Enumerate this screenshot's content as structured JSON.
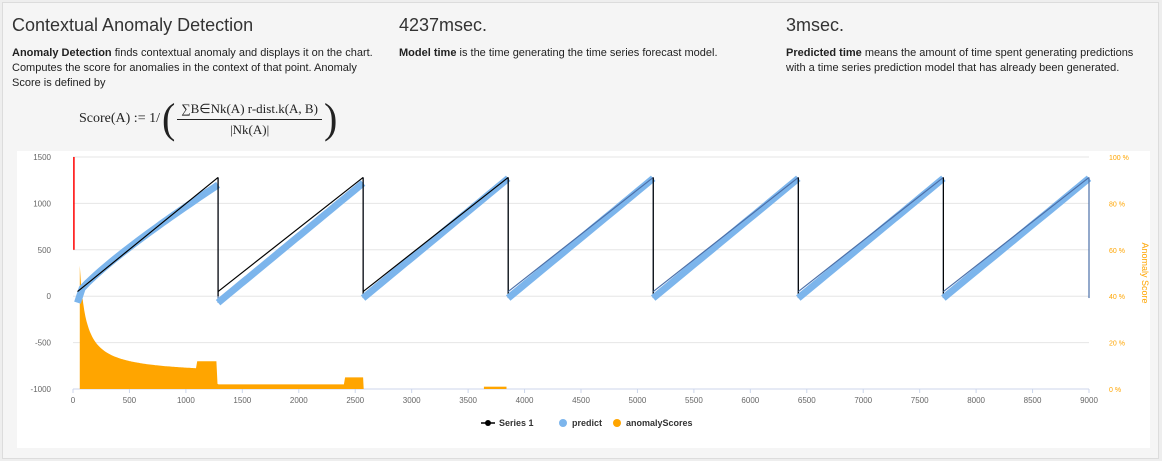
{
  "header": {
    "title": "Contextual Anomaly Detection",
    "desc_bold": "Anomaly Detection",
    "desc_rest": " finds contextual anomaly and displays it on the chart. Computes the score for anomalies in the context of that point. Anomaly Score is defined by",
    "formula_lhs": "Score(A) := 1/",
    "formula_num": "∑B∈Nk(A) r-dist.k(A, B)",
    "formula_den": "|Nk(A)|",
    "model_time_value": "4237msec.",
    "model_time_bold": "Model time",
    "model_time_rest": " is the time generating the time series forecast model.",
    "predicted_time_value": "3msec.",
    "predicted_time_bold": "Predicted time",
    "predicted_time_rest": " means the amount of time spent generating predictions with a time series prediction model that has already been generated."
  },
  "colors": {
    "series1": "#000000",
    "predict": "#7cb5ec",
    "predict_line": "#4b6fa8",
    "anomaly": "#ffa500",
    "anomaly_spike": "#ff0000",
    "grid": "#e6e6e6",
    "left_axis_text": "#666666",
    "right_axis_text": "#ffa500"
  },
  "chart_data": {
    "type": "line",
    "x_ticks": [
      0,
      500,
      1000,
      1500,
      2000,
      2500,
      3000,
      3500,
      4000,
      4500,
      5000,
      5500,
      6000,
      6500,
      7000,
      7500,
      8000,
      8500,
      9000
    ],
    "xlim": [
      0,
      9000
    ],
    "y_left": {
      "ticks": [
        1500,
        1000,
        500,
        0,
        -500,
        -1000
      ],
      "ylim": [
        -1000,
        1500
      ]
    },
    "y_right": {
      "label": "Anomaly Score",
      "ticks": [
        "100 %",
        "80 %",
        "60 %",
        "40 %",
        "20 %",
        "0 %"
      ],
      "ylim": [
        0,
        100
      ]
    },
    "sawtooth_period": 1285,
    "series": [
      {
        "name": "Series 1",
        "teeth": [
          [
            40,
            1285
          ],
          [
            1285,
            2570
          ],
          [
            2570,
            3855
          ],
          [
            3855,
            5140
          ],
          [
            5140,
            6425
          ],
          [
            6425,
            7710
          ],
          [
            7710,
            9000
          ]
        ],
        "y_start": 50,
        "y_end": 1280
      },
      {
        "name": "predict"
      },
      {
        "name": "anomalyScores",
        "segments": [
          [
            60,
            2575
          ],
          [
            3640,
            3840
          ]
        ],
        "plateaus": [
          [
            1100,
            1280,
            12
          ],
          [
            1280,
            2600,
            2
          ],
          [
            2400,
            2575,
            5
          ],
          [
            3640,
            3840,
            1
          ]
        ]
      }
    ],
    "legend": [
      "Series 1",
      "predict",
      "anomalyScores"
    ],
    "legend_position": "bottom-center",
    "grid": true
  }
}
